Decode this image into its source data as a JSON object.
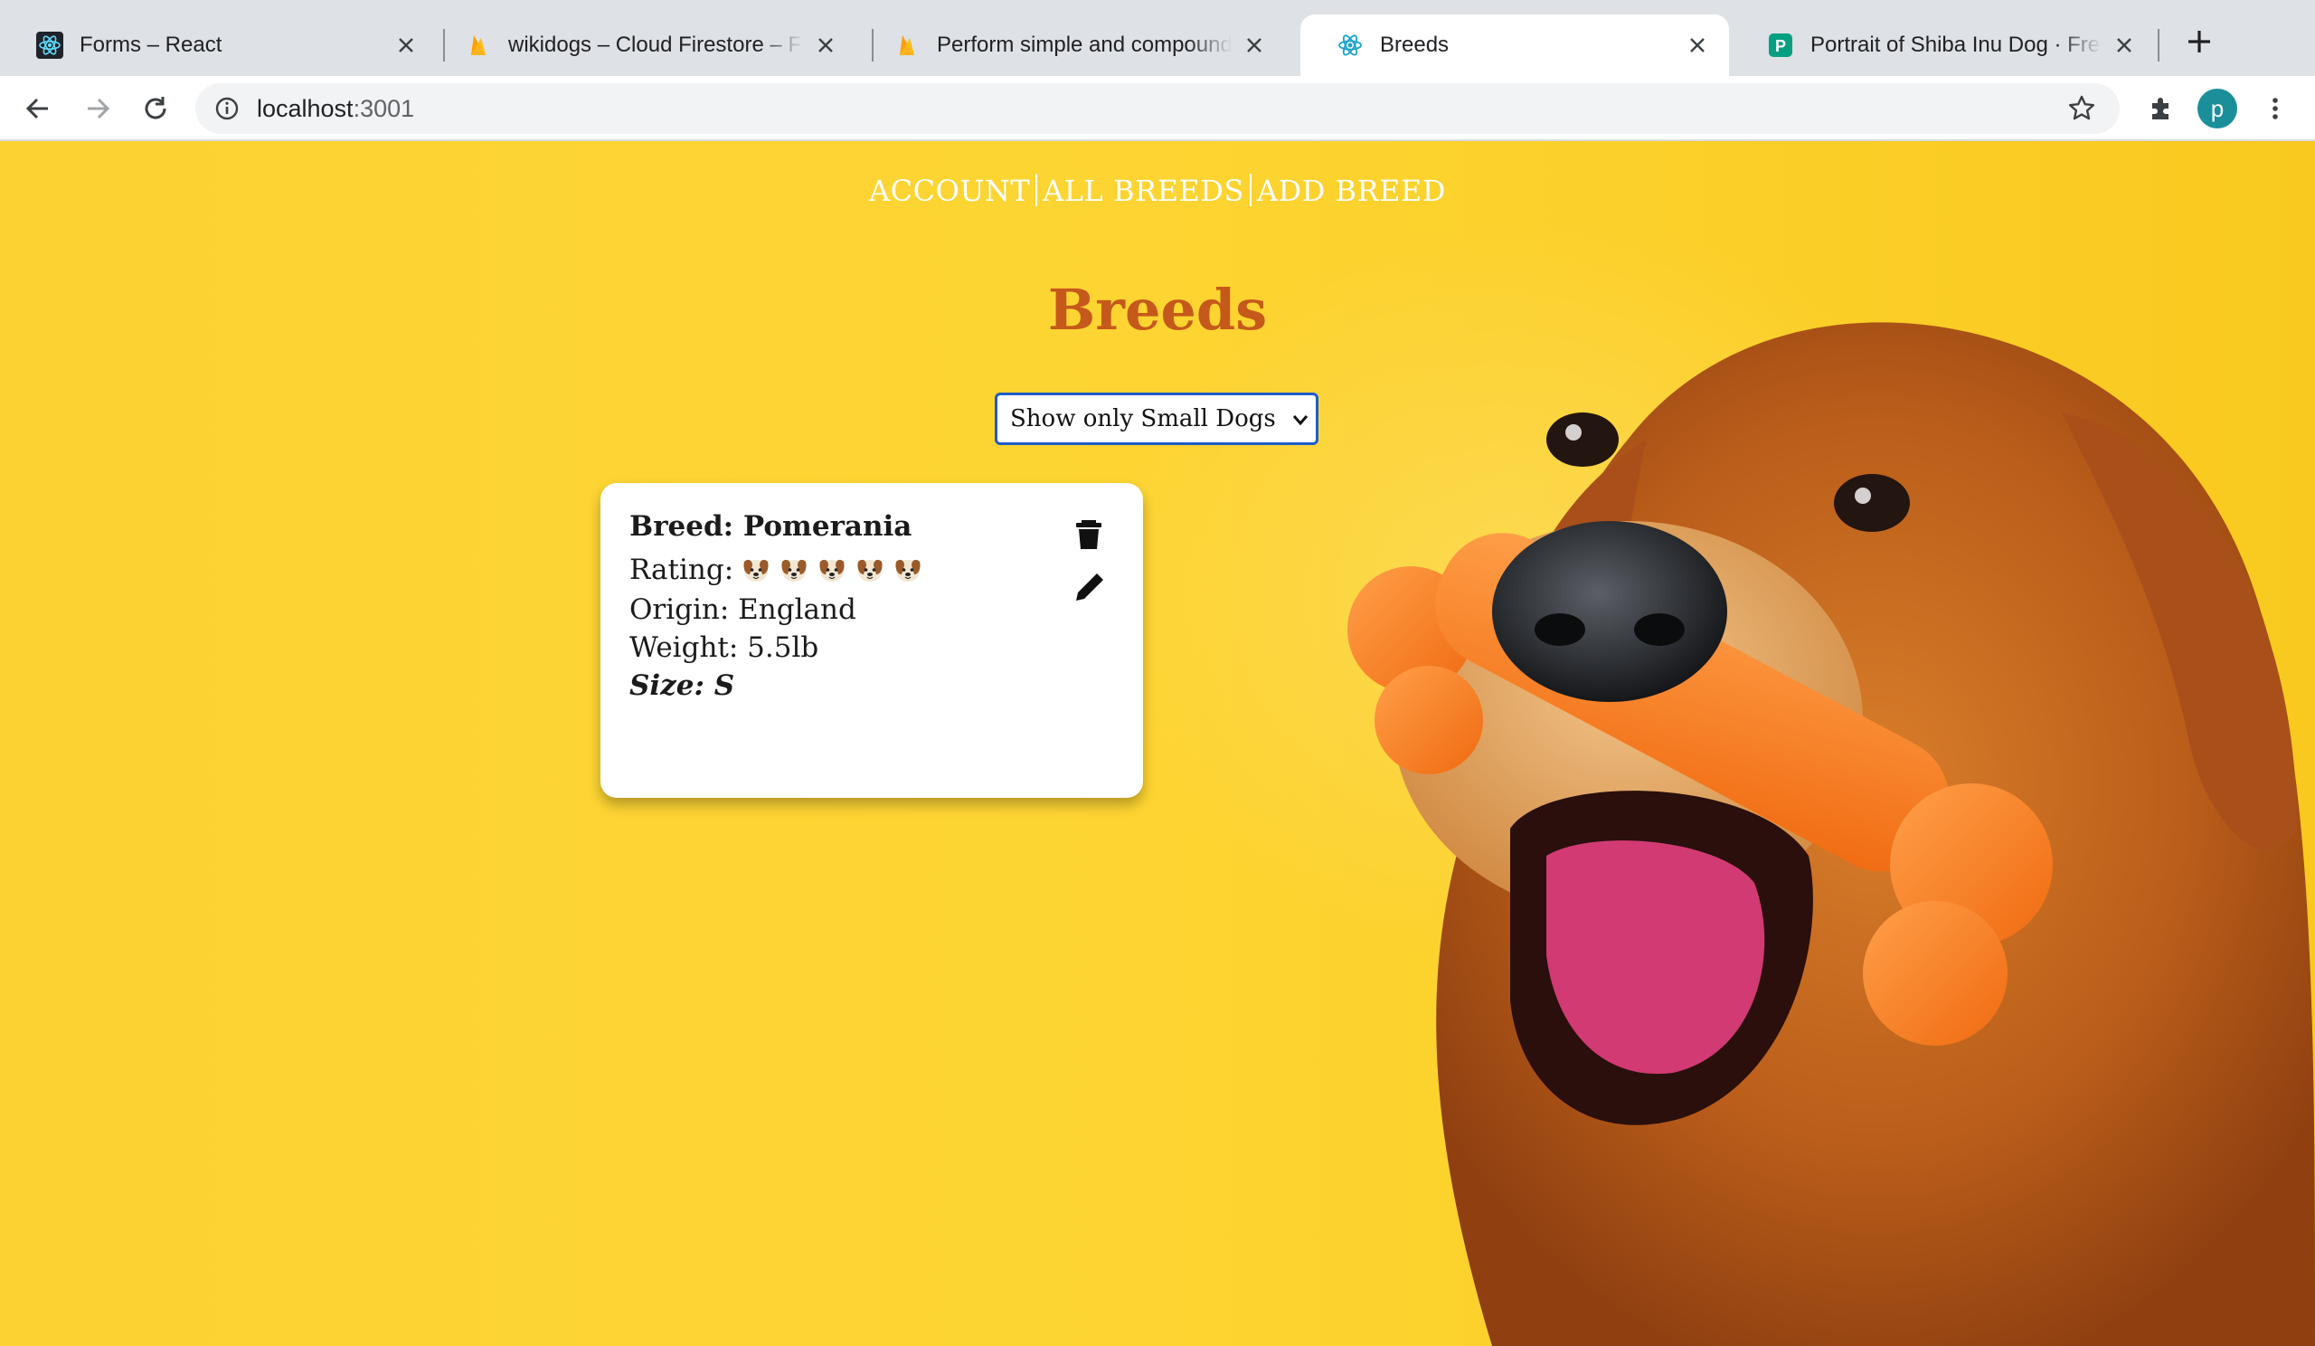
{
  "browser": {
    "tabs": [
      {
        "title": "Forms – React",
        "icon": "react-icon",
        "active": false
      },
      {
        "title": "wikidogs – Cloud Firestore – Fi",
        "icon": "firebase-icon",
        "active": false
      },
      {
        "title": "Perform simple and compound",
        "icon": "firebase-icon",
        "active": false
      },
      {
        "title": "Breeds",
        "icon": "react-icon",
        "active": true
      },
      {
        "title": "Portrait of Shiba Inu Dog · Free",
        "icon": "pexels-icon",
        "active": false
      }
    ],
    "url_host": "localhost",
    "url_port": ":3001",
    "profile_initial": "p"
  },
  "nav": {
    "account": "ACCOUNT",
    "all_breeds": "ALL BREEDS",
    "add_breed": "ADD BREED"
  },
  "page": {
    "heading": "Breeds",
    "filter_selected": "Show only Small Dogs"
  },
  "card": {
    "breed": "Breed: Pomerania",
    "rating_label": "Rating:",
    "rating_value": 5,
    "origin": "Origin: England",
    "weight": "Weight: 5.5lb",
    "size": "Size: S"
  },
  "colors": {
    "background": "#fcd233",
    "heading": "#c5591b",
    "select_border": "#1f5cc8",
    "profile": "#1a8f9a"
  }
}
